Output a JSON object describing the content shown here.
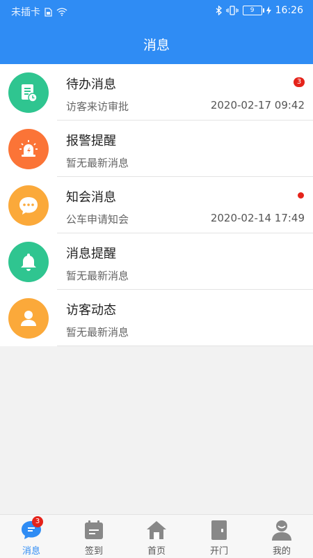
{
  "status_bar": {
    "carrier": "未插卡",
    "battery": "9",
    "time": "16:26"
  },
  "header": {
    "title": "消息"
  },
  "messages": [
    {
      "title": "待办消息",
      "subtitle": "访客来访审批",
      "time": "2020-02-17 09:42",
      "badge": "3",
      "icon": "document-clock-icon",
      "color": "#2fc590"
    },
    {
      "title": "报警提醒",
      "subtitle": "暂无最新消息",
      "icon": "alarm-siren-icon",
      "color": "#fb7437"
    },
    {
      "title": "知会消息",
      "subtitle": "公车申请知会",
      "time": "2020-02-14 17:49",
      "icon": "chat-bubble-icon",
      "color": "#fba93a"
    },
    {
      "title": "消息提醒",
      "subtitle": "暂无最新消息",
      "icon": "bell-icon",
      "color": "#2fc590"
    },
    {
      "title": "访客动态",
      "subtitle": "暂无最新消息",
      "icon": "person-icon",
      "color": "#fba93a"
    }
  ],
  "tabbar": {
    "tabs": [
      {
        "label": "消息",
        "icon": "message-icon",
        "badge": "3",
        "active": true
      },
      {
        "label": "签到",
        "icon": "calendar-icon"
      },
      {
        "label": "首页",
        "icon": "home-icon"
      },
      {
        "label": "开门",
        "icon": "door-icon"
      },
      {
        "label": "我的",
        "icon": "user-icon"
      }
    ]
  },
  "colors": {
    "primary": "#2f8cf4",
    "badge": "#e5231a"
  }
}
